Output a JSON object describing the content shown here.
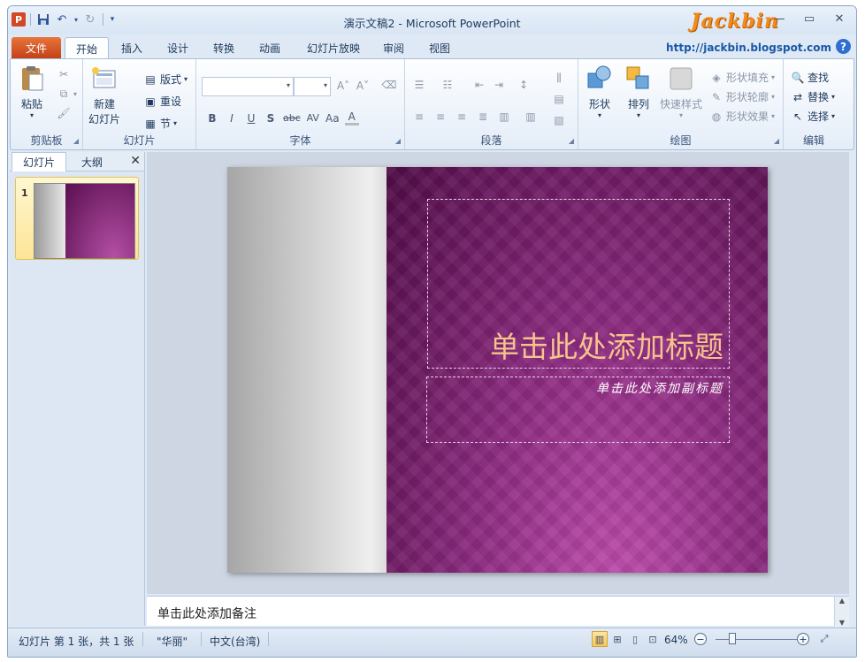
{
  "titlebar": {
    "title": "演示文稿2 - Microsoft PowerPoint",
    "app_icon_letter": "P",
    "brand": "Jackbin"
  },
  "tabs": [
    {
      "label": "文件"
    },
    {
      "label": "开始"
    },
    {
      "label": "插入"
    },
    {
      "label": "设计"
    },
    {
      "label": "转换"
    },
    {
      "label": "动画"
    },
    {
      "label": "幻灯片放映"
    },
    {
      "label": "审阅"
    },
    {
      "label": "视图"
    }
  ],
  "blog_link": "http://jackbin.blogspot.com",
  "help_label": "?",
  "ribbon": {
    "clipboard": {
      "label": "剪贴板",
      "paste": "粘贴"
    },
    "slides": {
      "label": "幻灯片",
      "new_slide_line1": "新建",
      "new_slide_line2": "幻灯片",
      "layout": "版式",
      "reset": "重设",
      "section": "节"
    },
    "font": {
      "label": "字体",
      "bold": "B",
      "italic": "I",
      "underline": "U",
      "shadow": "S",
      "strike": "abc",
      "spacing": "AV",
      "case": "Aa",
      "color": "A"
    },
    "paragraph": {
      "label": "段落"
    },
    "drawing": {
      "label": "绘图",
      "shapes": "形状",
      "arrange": "排列",
      "quick_styles": "快速样式",
      "shape_fill": "形状填充",
      "shape_outline": "形状轮廓",
      "shape_effects": "形状效果"
    },
    "editing": {
      "label": "编辑",
      "find": "查找",
      "replace": "替换",
      "select": "选择"
    }
  },
  "side_panel": {
    "tab_slides": "幻灯片",
    "tab_outline": "大纲",
    "close": "✕",
    "thumb_number": "1"
  },
  "slide": {
    "title_placeholder": "单击此处添加标题",
    "subtitle_placeholder": "单击此处添加副标题"
  },
  "notes": {
    "placeholder": "单击此处添加备注"
  },
  "status": {
    "slide_info": "幻灯片 第 1 张，共 1 张",
    "theme": "\"华丽\"",
    "language": "中文(台湾)",
    "zoom": "64%"
  }
}
